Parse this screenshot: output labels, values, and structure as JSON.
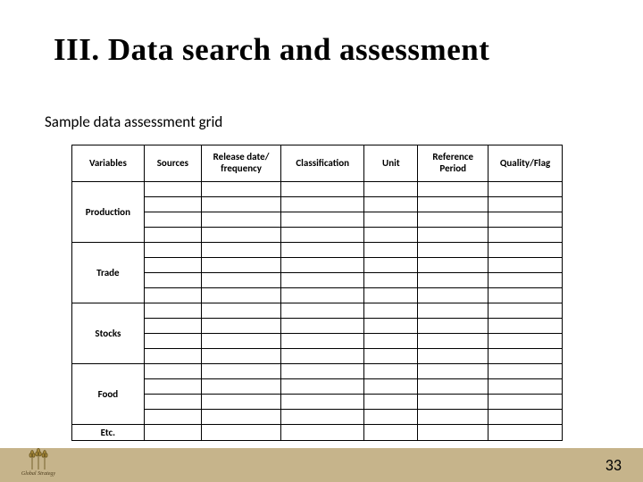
{
  "title": "III. Data search and assessment",
  "subtitle": "Sample data assessment grid",
  "columns": [
    "Variables",
    "Sources",
    "Release date/ frequency",
    "Classification",
    "Unit",
    "Reference Period",
    "Quality/Flag"
  ],
  "row_groups": [
    {
      "label": "Production",
      "subrows": 4
    },
    {
      "label": "Trade",
      "subrows": 4
    },
    {
      "label": "Stocks",
      "subrows": 4
    },
    {
      "label": "Food",
      "subrows": 4
    },
    {
      "label": "Etc.",
      "subrows": 1
    }
  ],
  "page_number": "33",
  "logo_text": "Global Strategy",
  "footer_color": "#c6b48b"
}
